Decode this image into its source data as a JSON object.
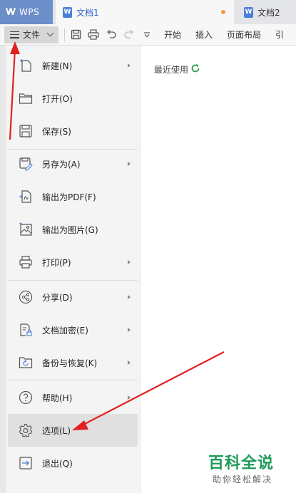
{
  "tabs": {
    "app_label": "WPS",
    "documents": [
      {
        "label": "文档1",
        "active": true,
        "unsaved": true
      },
      {
        "label": "文档2",
        "active": false
      }
    ]
  },
  "toolbar": {
    "file_label": "文件",
    "menu_tabs": [
      "开始",
      "插入",
      "页面布局",
      "引"
    ]
  },
  "file_menu": {
    "items": [
      {
        "label": "新建(N)",
        "icon": "new-document-icon",
        "submenu": true
      },
      {
        "label": "打开(O)",
        "icon": "folder-open-icon",
        "submenu": false
      },
      {
        "label": "保存(S)",
        "icon": "save-icon",
        "submenu": false
      },
      {
        "label": "另存为(A)",
        "icon": "save-as-icon",
        "submenu": true
      },
      {
        "label": "输出为PDF(F)",
        "icon": "export-pdf-icon",
        "submenu": false
      },
      {
        "label": "输出为图片(G)",
        "icon": "export-image-icon",
        "submenu": false
      },
      {
        "label": "打印(P)",
        "icon": "printer-icon",
        "submenu": true
      },
      {
        "label": "分享(D)",
        "icon": "share-icon",
        "submenu": true
      },
      {
        "label": "文档加密(E)",
        "icon": "document-lock-icon",
        "submenu": true
      },
      {
        "label": "备份与恢复(K)",
        "icon": "backup-restore-icon",
        "submenu": true
      },
      {
        "label": "帮助(H)",
        "icon": "help-icon",
        "submenu": true
      },
      {
        "label": "选项(L)",
        "icon": "gear-icon",
        "submenu": false,
        "highlighted": true
      },
      {
        "label": "退出(Q)",
        "icon": "exit-icon",
        "submenu": false
      }
    ]
  },
  "recent": {
    "title": "最近使用"
  },
  "watermark": {
    "main": "百科全说",
    "sub": "助你轻松解决"
  },
  "colors": {
    "wps_tab": "#6d8fc9",
    "active_tab_text": "#2f66c7",
    "annotation_arrow": "#e02020",
    "watermark_green": "#1f9a5a",
    "highlight_row": "#e0e0e0"
  }
}
